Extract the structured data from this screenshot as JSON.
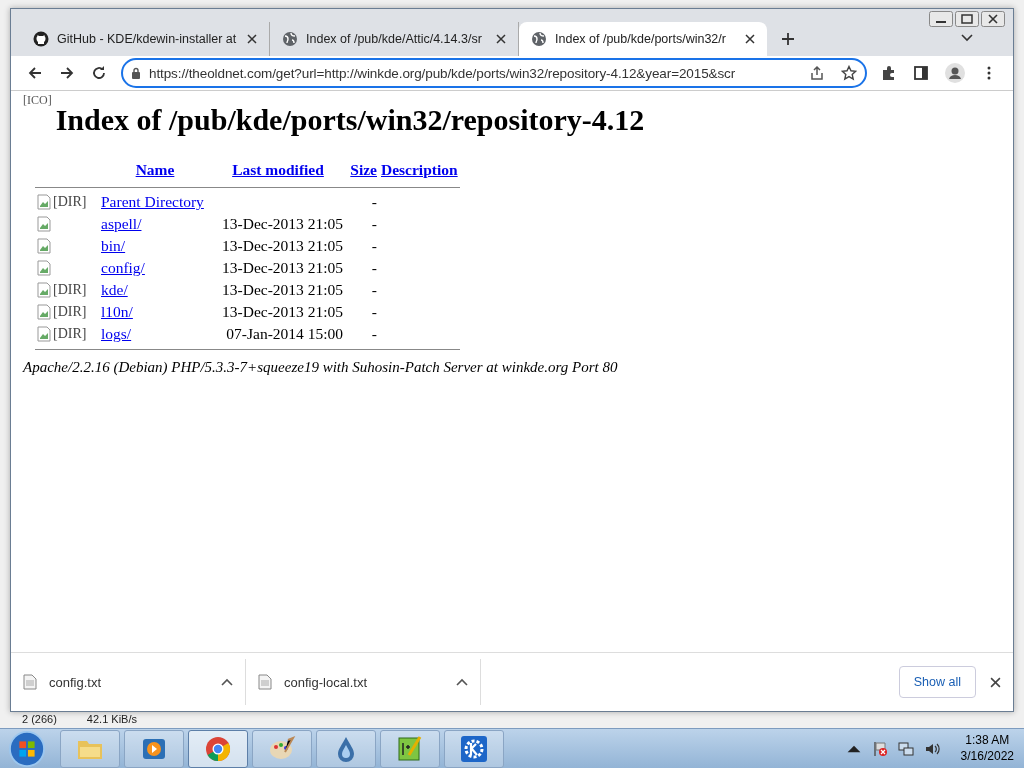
{
  "tabs": [
    {
      "title": "GitHub - KDE/kdewin-installer at",
      "kind": "github",
      "selected": false
    },
    {
      "title": "Index of /pub/kde/Attic/4.14.3/sr",
      "kind": "globe",
      "selected": false
    },
    {
      "title": "Index of /pub/kde/ports/win32/r",
      "kind": "globe",
      "selected": true
    }
  ],
  "address": {
    "url": "https://theoldnet.com/get?url=http://winkde.org/pub/kde/ports/win32/repository-4.12&year=2015&scr"
  },
  "page": {
    "heading": "Index of /pub/kde/ports/win32/repository-4.12",
    "icon_header_alt": "[ICO]",
    "columns": [
      "Name",
      "Last modified",
      "Size",
      "Description"
    ],
    "rows": [
      {
        "name": "Parent Directory",
        "modified": "",
        "size": "-",
        "alt": "[DIR]"
      },
      {
        "name": "aspell/",
        "modified": "13-Dec-2013 21:05",
        "size": "-",
        "alt": ""
      },
      {
        "name": "bin/",
        "modified": "13-Dec-2013 21:05",
        "size": "-",
        "alt": ""
      },
      {
        "name": "config/",
        "modified": "13-Dec-2013 21:05",
        "size": "-",
        "alt": ""
      },
      {
        "name": "kde/",
        "modified": "13-Dec-2013 21:05",
        "size": "-",
        "alt": "[DIR]"
      },
      {
        "name": "l10n/",
        "modified": "13-Dec-2013 21:05",
        "size": "-",
        "alt": "[DIR]"
      },
      {
        "name": "logs/",
        "modified": "07-Jan-2014 15:00",
        "size": "-",
        "alt": "[DIR]"
      }
    ],
    "footer": "Apache/2.2.16 (Debian) PHP/5.3.3-7+squeeze19 with Suhosin-Patch Server at winkde.org Port 80"
  },
  "downloads": [
    {
      "name": "config.txt"
    },
    {
      "name": "config-local.txt"
    }
  ],
  "show_all": "Show all",
  "back_window": {
    "status_1": "2 (266)",
    "status_2": "42.1 KiB/s"
  },
  "taskbar": {
    "apps": [
      {
        "kind": "folder",
        "selected": false
      },
      {
        "kind": "media",
        "selected": false
      },
      {
        "kind": "chrome",
        "selected": true
      },
      {
        "kind": "paint",
        "selected": false
      },
      {
        "kind": "drop",
        "selected": false
      },
      {
        "kind": "notepad",
        "selected": false
      },
      {
        "kind": "kde",
        "selected": false
      }
    ],
    "time": "1:38 AM",
    "date": "3/16/2022"
  }
}
